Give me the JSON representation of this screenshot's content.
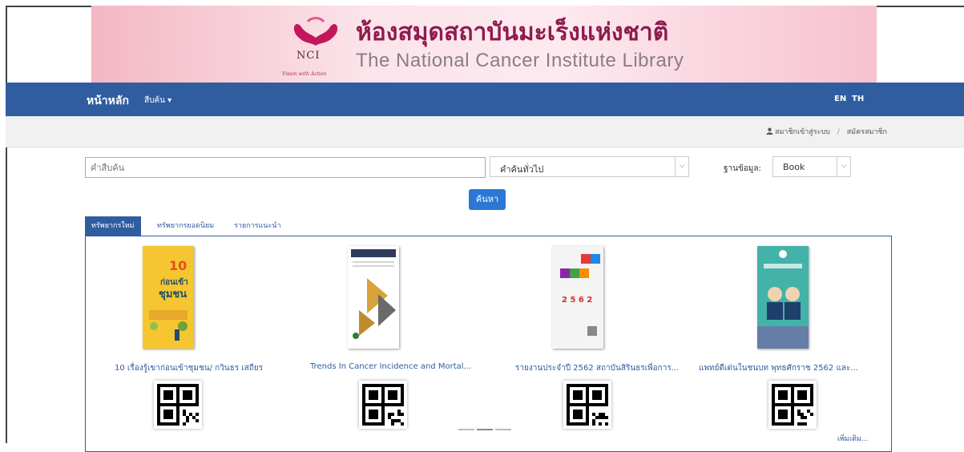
{
  "banner": {
    "title_th": "ห้องสมุดสถาบันมะเร็งแห่งชาติ",
    "title_en": "The National Cancer Institute Library",
    "logo_text": "NCI",
    "logo_tagline": "Vision with Action"
  },
  "nav": {
    "home": "หน้าหลัก",
    "search_menu": "สืบค้น ▾",
    "lang_en": "EN",
    "lang_th": "TH"
  },
  "user_links": {
    "login": "สมาชิกเข้าสู่ระบบ",
    "separator": "/",
    "register": "สมัครสมาชิก"
  },
  "search": {
    "placeholder": "คำสืบค้น",
    "type_selected": "คำค้นทั่วไป",
    "db_label": "ฐานข้อมูล:",
    "db_selected": "Book",
    "button": "ค้นหา"
  },
  "tabs": [
    {
      "label": "ทรัพยากรใหม่",
      "active": true
    },
    {
      "label": "ทรัพยากรยอดนิยม",
      "active": false
    },
    {
      "label": "รายการแนะนำ",
      "active": false
    }
  ],
  "books": [
    {
      "title": "10 เรื่องรู้เขาก่อนเข้าชุมชน/ กวินธร เสถียร",
      "cover_color": "#f2c22c",
      "icon": "book-cover"
    },
    {
      "title": "Trends In Cancer Incidence and Mortal...",
      "cover_color": "#ffffff",
      "icon": "book-cover"
    },
    {
      "title": "รายงานประจำปี 2562 สถาบันสิรินธรเพื่อการ...",
      "cover_color": "#f4f4f4",
      "icon": "book-cover"
    },
    {
      "title": "แพทย์ดีเด่นในชนบท พุทธศักราช 2562 และ...",
      "cover_color": "#3aa7a0",
      "icon": "book-cover"
    }
  ],
  "more_link": "เพิ่มเติม..."
}
